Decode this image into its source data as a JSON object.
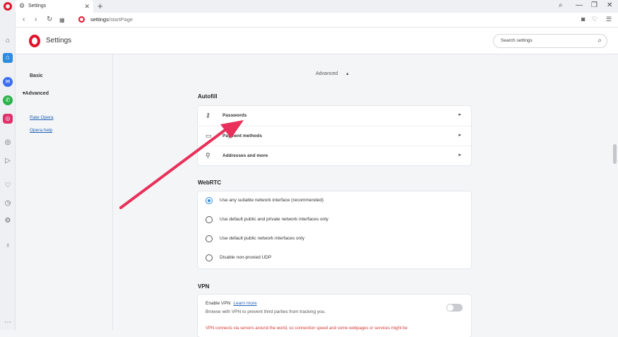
{
  "tab": {
    "title": "Settings"
  },
  "address": {
    "url_strong": "settings",
    "url_rest": "/startPage"
  },
  "header": {
    "title": "Settings"
  },
  "search": {
    "placeholder": "Search settings"
  },
  "leftmenu": {
    "basic": "Basic",
    "advanced": "Advanced",
    "rate": "Rate Opera",
    "help": "Opera help"
  },
  "advanced_toggle": "Advanced",
  "autofill": {
    "title": "Autofill",
    "items": [
      "Passwords",
      "Payment methods",
      "Addresses and more"
    ]
  },
  "webrtc": {
    "title": "WebRTC",
    "options": [
      "Use any suitable network interface (recommended)",
      "Use default public and private network interfaces only",
      "Use default public network interfaces only",
      "Disable non-proxied UDP"
    ],
    "selected_index": 0
  },
  "vpn": {
    "title": "VPN",
    "enable_label": "Enable VPN",
    "learn_more": "Learn more",
    "description": "Browse with VPN to prevent third parties from tracking you.",
    "warning": "VPN connects via servers around the world, so connection speed and some webpages or services might be",
    "enabled": false
  },
  "colors": {
    "accent": "#2d8ae3",
    "brand": "#e0142c",
    "annotation_arrow": "#e8305a"
  },
  "icons": {
    "sidebar": [
      "home-icon",
      "speed-dial-icon",
      "messenger-icon",
      "whatsapp-icon",
      "instagram-icon",
      "flow-icon",
      "send-icon",
      "bookmarks-heart-icon",
      "history-icon",
      "extensions-gear-icon",
      "tips-bulb-icon",
      "more-icon"
    ]
  }
}
